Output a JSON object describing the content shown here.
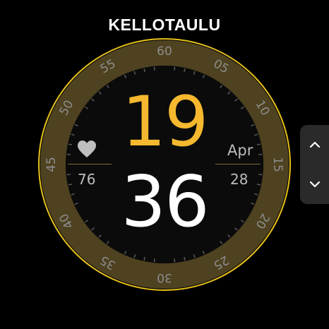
{
  "screen": {
    "title": "KELLOTAULU"
  },
  "watchface": {
    "hour": "19",
    "minute": "36",
    "heart_rate": "76",
    "month": "Apr",
    "day": "28",
    "bezel_labels": [
      "60",
      "05",
      "10",
      "15",
      "20",
      "25",
      "30",
      "35",
      "40",
      "45",
      "50",
      "55"
    ]
  },
  "colors": {
    "accent": "#f5b82e",
    "ring": "#e8c21c",
    "bezel": "#5a4b24",
    "text_secondary": "#bdbdbd"
  },
  "icons": {
    "heart": "heart-icon",
    "up": "chevron-up-icon",
    "down": "chevron-down-icon"
  }
}
